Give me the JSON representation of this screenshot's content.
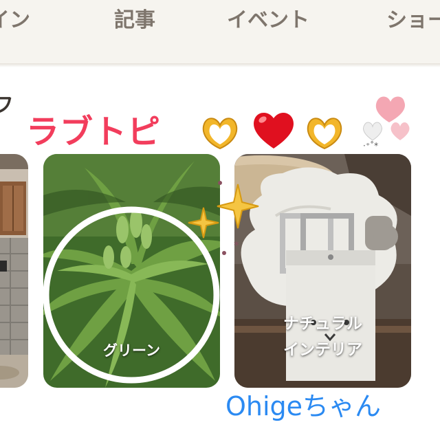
{
  "nav": {
    "items": [
      {
        "label": "イン"
      },
      {
        "label": "記事"
      },
      {
        "label": "イベント"
      },
      {
        "label": "ショー"
      }
    ]
  },
  "section": {
    "head": "フ"
  },
  "cards": [
    {
      "id": "house",
      "label": ""
    },
    {
      "id": "green",
      "label": "グリーン"
    },
    {
      "id": "natural",
      "label_line1": "ナチュラル",
      "label_line2": "インテリア"
    }
  ],
  "overlay": {
    "title": "ラブトピ",
    "author": "Ohigeちゃん",
    "icons": [
      "heart-hands-icon",
      "red-heart-icon",
      "heart-hands-icon",
      "hearts-cluster-icon",
      "sparkles-icon"
    ]
  },
  "colors": {
    "nav_bg": "#f6f4ef",
    "nav_text": "#7e756c",
    "title_pink": "#f23d5c",
    "author_blue": "#2b8af2"
  }
}
